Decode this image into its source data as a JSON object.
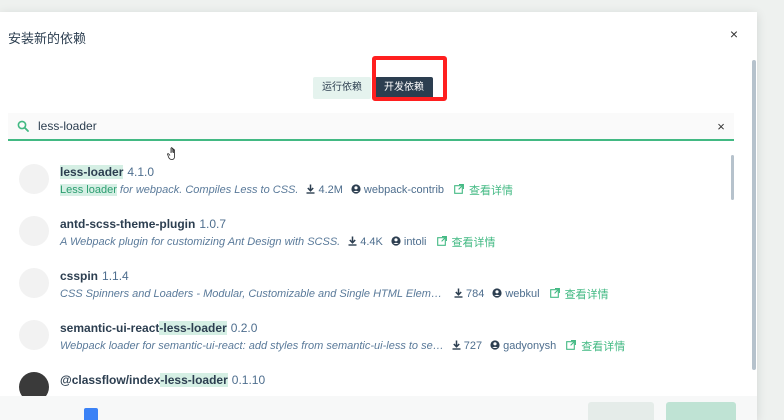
{
  "dialog": {
    "title": "安装新的依赖",
    "close_glyph": "×"
  },
  "tabs": [
    {
      "label": "运行依赖",
      "active": false
    },
    {
      "label": "开发依赖",
      "active": true
    }
  ],
  "search": {
    "value": "less-loader",
    "clear_glyph": "×"
  },
  "packages": [
    {
      "name_parts": [
        {
          "text": "less-loader",
          "hl": true
        }
      ],
      "version": "4.1.0",
      "desc_parts": [
        {
          "text": "Less loader",
          "hl": true
        },
        {
          "text": " for webpack. Compiles Less to CSS.",
          "hl": false
        }
      ],
      "downloads": "4.2M",
      "author": "webpack-contrib",
      "details_label": "查看详情"
    },
    {
      "name_parts": [
        {
          "text": "antd-scss-theme-plugin",
          "hl": false
        }
      ],
      "version": "1.0.7",
      "desc_parts": [
        {
          "text": "A Webpack plugin for customizing Ant Design with SCSS.",
          "hl": false
        }
      ],
      "downloads": "4.4K",
      "author": "intoli",
      "details_label": "查看详情"
    },
    {
      "name_parts": [
        {
          "text": "csspin",
          "hl": false
        }
      ],
      "version": "1.1.4",
      "desc_parts": [
        {
          "text": "CSS Spinners and Loaders - Modular, Customizable and Single HTML Element…",
          "hl": false
        }
      ],
      "downloads": "784",
      "author": "webkul",
      "details_label": "查看详情"
    },
    {
      "name_parts": [
        {
          "text": "semantic-ui-react",
          "hl": false
        },
        {
          "text": "-less-loader",
          "hl": true
        }
      ],
      "version": "0.2.0",
      "desc_parts": [
        {
          "text": "Webpack loader for semantic-ui-react: add styles from semantic-ui-less to se…",
          "hl": false
        }
      ],
      "downloads": "727",
      "author": "gadyonysh",
      "details_label": "查看详情"
    },
    {
      "name_parts": [
        {
          "text": "@classflow/index",
          "hl": false
        },
        {
          "text": "-less-loader",
          "hl": true
        }
      ],
      "version": "0.1.10",
      "desc_parts": [],
      "downloads": "",
      "author": "",
      "details_label": ""
    }
  ],
  "colors": {
    "accent": "#42b983",
    "dark": "#2c3e50",
    "highlight_bg": "#d5efe4",
    "annotation_red": "#ff1f1f"
  },
  "icons": {
    "search": "search-icon",
    "download": "download-icon",
    "author": "user-icon",
    "external": "external-link-icon"
  }
}
